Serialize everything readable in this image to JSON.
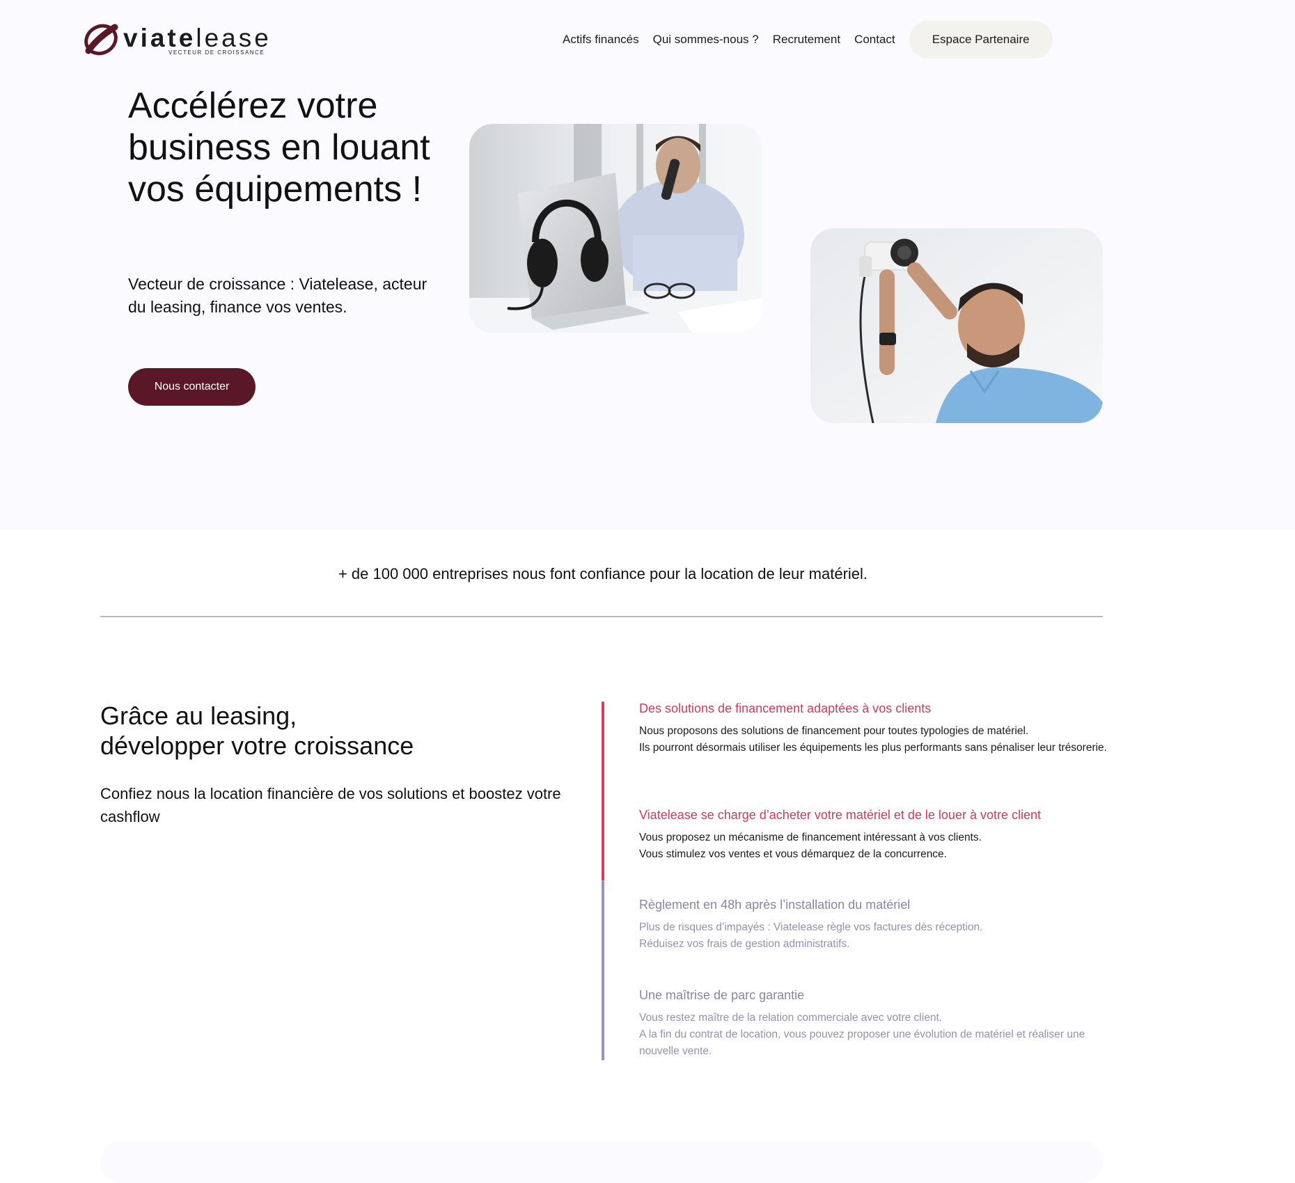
{
  "brand": {
    "name_bold": "viate",
    "name_light": "lease",
    "tagline": "Vecteur de croissance",
    "color_primary": "#5a1826",
    "color_accent": "#d0395c"
  },
  "nav": {
    "items": [
      "Actifs financés",
      "Qui sommes-nous ?",
      "Recrutement",
      "Contact"
    ],
    "cta_label": "Espace Partenaire"
  },
  "hero": {
    "title": "Accélérez votre business en louant vos équipements !",
    "subtitle": "Vecteur de croissance : Viatelease, acteur du leasing, finance vos ventes.",
    "button_label": "Nous contacter",
    "images": [
      "photo-support-client-casque",
      "photo-installation-camera"
    ]
  },
  "trust": {
    "text": "+ de 100 000 entreprises nous font confiance pour la location de leur matériel."
  },
  "growth": {
    "title_line1": "Grâce au leasing,",
    "title_line2": "développer votre croissance",
    "subtitle": "Confiez nous la location financière de vos solutions et boostez votre cashflow",
    "features": [
      {
        "title": "Des solutions de financement adaptées à vos clients",
        "description": "Nous proposons des solutions de financement pour toutes typologies de matériel.\nIls pourront désormais utiliser les équipements les plus performants sans pénaliser leur trésorerie."
      },
      {
        "title": "Viatelease se charge d’acheter votre matériel et de le louer à votre client",
        "description": "Vous proposez un mécanisme de financement intéressant à vos clients.\nVous stimulez vos ventes et vous démarquez de la concurrence."
      },
      {
        "title": "Règlement en 48h après l’installation du matériel",
        "description": "Plus de risques d’impayés : Viatelease règle vos factures dès réception.\nRéduisez vos frais de gestion administratifs."
      },
      {
        "title": "Une maîtrise de parc garantie",
        "description": "Vous restez maître de la relation commerciale avec votre client.\nA la fin du contrat de location, vous pouvez proposer une évolution de matériel et réaliser une nouvelle vente."
      }
    ]
  }
}
